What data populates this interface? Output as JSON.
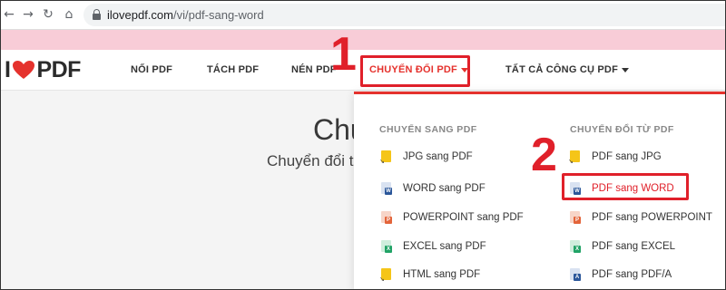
{
  "browser": {
    "url_host": "ilovepdf.com",
    "url_path": "/vi/pdf-sang-word",
    "back_icon": "←",
    "forward_icon": "→",
    "reload_icon": "↻",
    "home_icon": "⌂"
  },
  "header": {
    "logo_left": "I",
    "logo_right": "PDF",
    "nav": [
      {
        "label": "NỐI PDF"
      },
      {
        "label": "TÁCH PDF"
      },
      {
        "label": "NÉN PDF"
      },
      {
        "label": "CHUYỂN ĐỔI PDF"
      },
      {
        "label": "TẤT CẢ CÔNG CỤ PDF"
      }
    ]
  },
  "annotations": {
    "step1": "1",
    "step2": "2",
    "highlight_color": "#e0202a"
  },
  "main": {
    "title": "Chu",
    "subtitle": "Chuyển đổi t"
  },
  "dropdown": {
    "to_pdf": {
      "heading": "CHUYỂN SANG PDF",
      "items": [
        {
          "label": "JPG sang PDF",
          "icon": "jpg-icon",
          "color": "#f5c518",
          "tag": ""
        },
        {
          "label": "WORD sang PDF",
          "icon": "word-icon",
          "color": "#2b579a",
          "tag": "W"
        },
        {
          "label": "POWERPOINT sang PDF",
          "icon": "powerpoint-icon",
          "color": "#e3643a",
          "tag": "P"
        },
        {
          "label": "EXCEL sang PDF",
          "icon": "excel-icon",
          "color": "#21a366",
          "tag": "X"
        },
        {
          "label": "HTML sang PDF",
          "icon": "html-icon",
          "color": "#f5c518",
          "tag": ""
        }
      ]
    },
    "from_pdf": {
      "heading": "CHUYỂN ĐỔI TỪ PDF",
      "items": [
        {
          "label": "PDF sang JPG",
          "icon": "jpg-icon",
          "color": "#f5c518",
          "tag": ""
        },
        {
          "label": "PDF sang WORD",
          "icon": "word-icon",
          "color": "#2b579a",
          "tag": "W"
        },
        {
          "label": "PDF sang POWERPOINT",
          "icon": "powerpoint-icon",
          "color": "#e3643a",
          "tag": "P"
        },
        {
          "label": "PDF sang EXCEL",
          "icon": "excel-icon",
          "color": "#21a366",
          "tag": "X"
        },
        {
          "label": "PDF sang PDF/A",
          "icon": "pdfa-icon",
          "color": "#2b579a",
          "tag": "A"
        }
      ]
    }
  },
  "colors": {
    "brand_red": "#e5322d",
    "pink_strip": "#f8ccd7"
  }
}
